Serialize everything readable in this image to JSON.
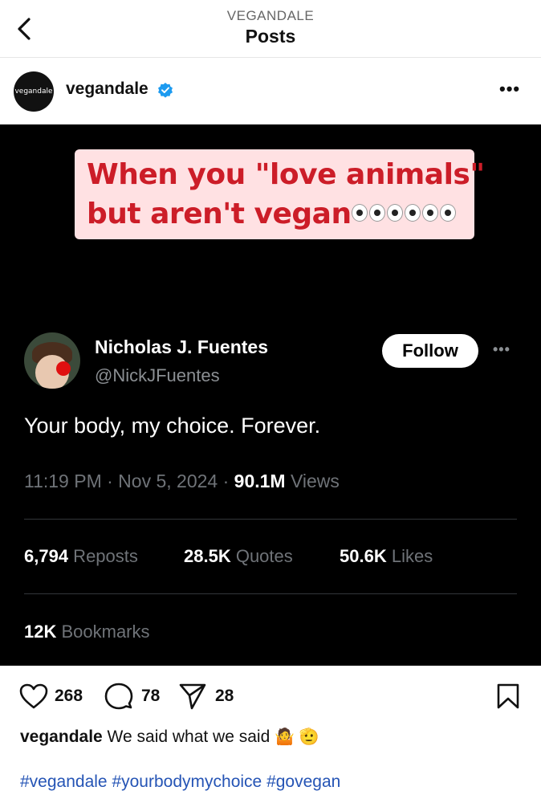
{
  "topbar": {
    "account": "VEGANDALE",
    "title": "Posts"
  },
  "post_header": {
    "avatar_text": "vegandale",
    "username": "vegandale"
  },
  "media": {
    "caption_line1": "When you \"love animals\"",
    "caption_line2": "but aren't vegan",
    "tweet": {
      "name": "Nicholas J. Fuentes",
      "handle": "@NickJFuentes",
      "follow_label": "Follow",
      "text": "Your body, my choice. Forever.",
      "time": "11:19 PM · Nov 5, 2024 · ",
      "views_count": "90.1M",
      "views_label": " Views",
      "reposts_count": "6,794",
      "reposts_label": " Reposts",
      "quotes_count": "28.5K",
      "quotes_label": " Quotes",
      "likes_count": "50.6K",
      "likes_label": " Likes",
      "bookmarks_count": "12K",
      "bookmarks_label": " Bookmarks"
    }
  },
  "actions": {
    "likes": "268",
    "comments": "78",
    "shares": "28"
  },
  "caption": {
    "username": "vegandale",
    "text": " We said what we said ",
    "hashtags": [
      "#vegandale",
      "#yourbodymychoice",
      "#govegan"
    ]
  },
  "colors": {
    "verified": "#1d9bf0",
    "caption_red": "#cc1d28",
    "caption_bg": "#ffe1e3",
    "hashtag": "#2554b5"
  },
  "icons": [
    "back-chevron-icon",
    "verified-badge-icon",
    "more-options-icon",
    "heart-icon",
    "comment-icon",
    "share-icon",
    "bookmark-icon"
  ]
}
